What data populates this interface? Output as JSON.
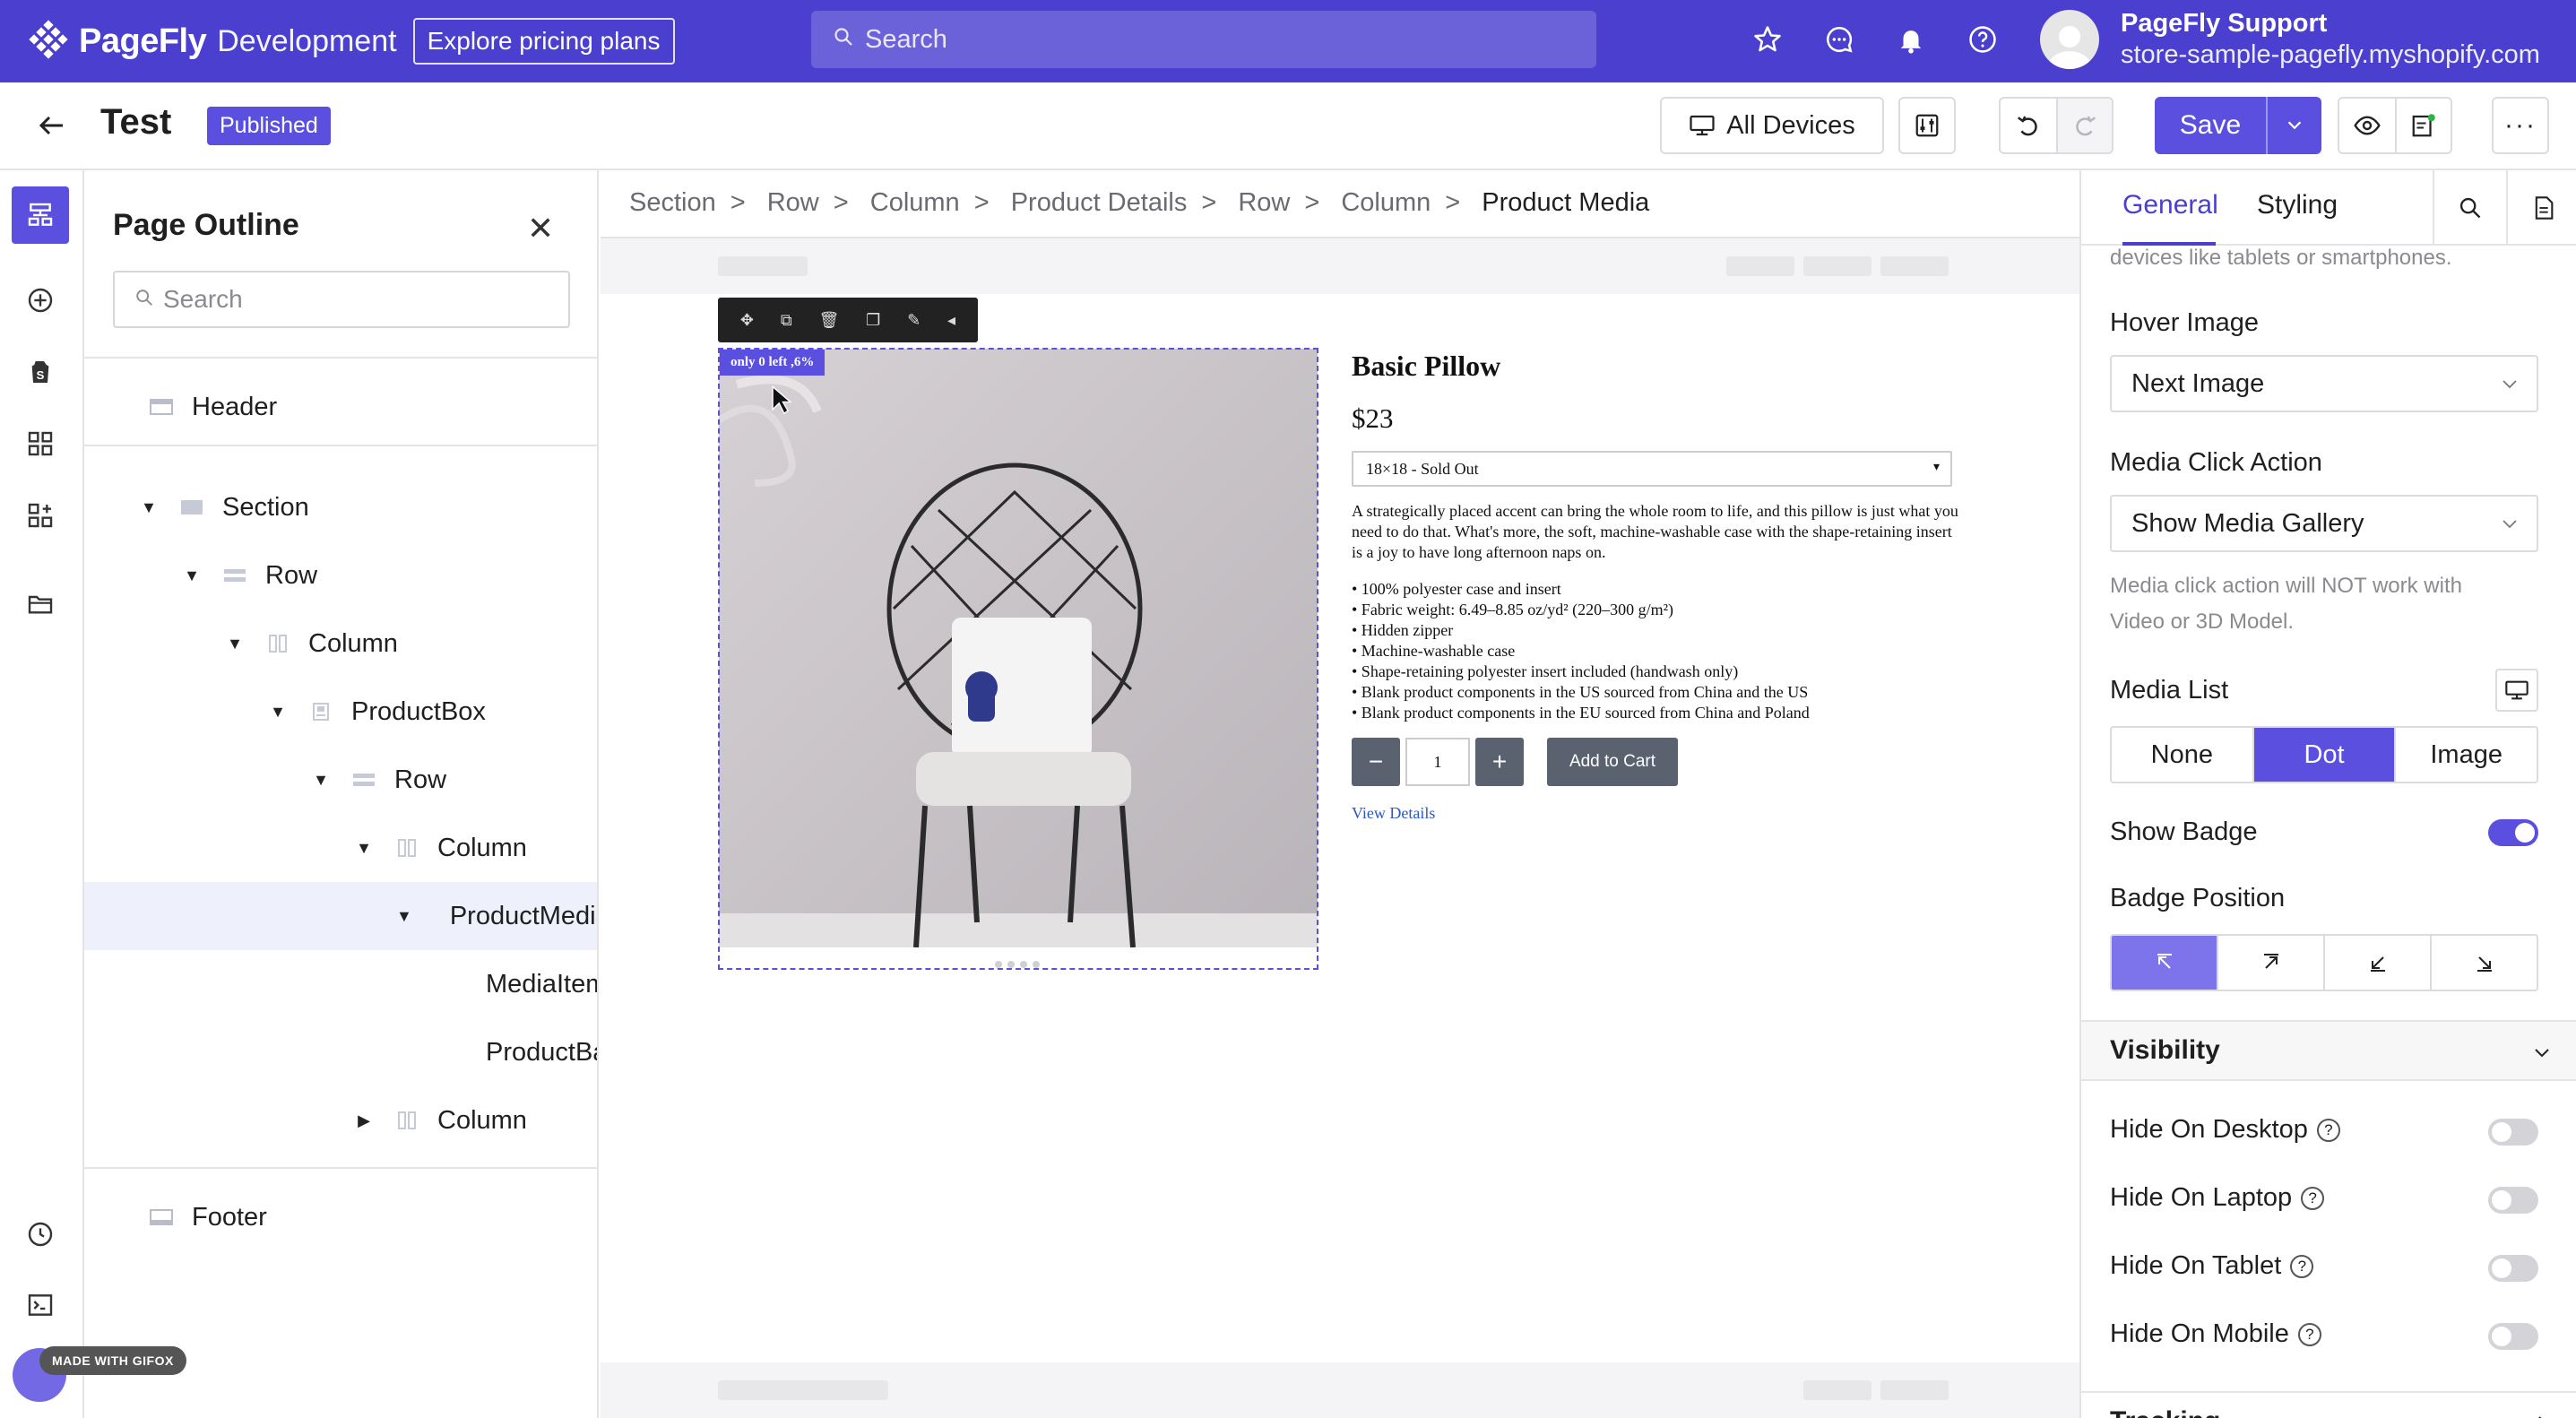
{
  "topbar": {
    "brand": "PageFly",
    "brand_sub": "Development",
    "explore_label": "Explore pricing plans",
    "search_placeholder": "Search",
    "user_name": "PageFly Support",
    "user_store": "store-sample-pagefly.myshopify.com",
    "icons": [
      "star-icon",
      "chat-icon",
      "bell-icon",
      "help-icon"
    ]
  },
  "header": {
    "title": "Test",
    "status": "Published",
    "devices_label": "All Devices",
    "save_label": "Save"
  },
  "outline": {
    "title": "Page Outline",
    "search_placeholder": "Search",
    "items": [
      {
        "label": "Header"
      },
      {
        "label": "Section"
      },
      {
        "label": "Row"
      },
      {
        "label": "Column"
      },
      {
        "label": "ProductBox"
      },
      {
        "label": "Row"
      },
      {
        "label": "Column"
      },
      {
        "label": "ProductMedia"
      },
      {
        "label": "MediaItem"
      },
      {
        "label": "ProductBadge"
      },
      {
        "label": "Column"
      },
      {
        "label": "Footer"
      }
    ]
  },
  "breadcrumb": [
    "Section",
    "Row",
    "Column",
    "Product Details",
    "Row",
    "Column",
    "Product Media"
  ],
  "canvas": {
    "badge": "only 0 left ,6%",
    "product_title": "Basic Pillow",
    "price": "$23",
    "variant": "18×18 - Sold Out",
    "description": "A strategically placed accent can bring the whole room to life, and this pillow is just what you need to do that. What's more, the soft, machine-washable case with the shape-retaining insert is a joy to have long afternoon naps on.",
    "features": [
      "• 100% polyester case and insert",
      "• Fabric weight: 6.49–8.85 oz/yd² (220–300 g/m²)",
      "• Hidden zipper",
      "• Machine-washable case",
      "• Shape-retaining polyester insert included (handwash only)",
      "• Blank product components in the US sourced from China and the US",
      "• Blank product components in the EU sourced from China and Poland"
    ],
    "quantity": "1",
    "minus": "−",
    "plus": "+",
    "add_to_cart": "Add to Cart",
    "view_details": "View Details"
  },
  "panel": {
    "tab_general": "General",
    "tab_styling": "Styling",
    "top_note": "devices like tablets or smartphones.",
    "hover_image_label": "Hover Image",
    "hover_image_value": "Next Image",
    "click_action_label": "Media Click Action",
    "click_action_value": "Show Media Gallery",
    "click_action_note_1": "Media click action will NOT work with",
    "click_action_note_2": "Video or 3D Model.",
    "media_list_label": "Media List",
    "media_list_options": [
      "None",
      "Dot",
      "Image"
    ],
    "media_list_selected": "Dot",
    "show_badge_label": "Show Badge",
    "show_badge_on": true,
    "badge_position_label": "Badge Position",
    "visibility_label": "Visibility",
    "hide_desktop": "Hide On Desktop",
    "hide_laptop": "Hide On Laptop",
    "hide_tablet": "Hide On Tablet",
    "hide_mobile": "Hide On Mobile",
    "help_glyph": "?",
    "tracking_label": "Tracking"
  },
  "gifox": "MADE WITH GIFOX",
  "colors": {
    "brand": "#4b3fd0",
    "accent": "#5b4fe0"
  }
}
